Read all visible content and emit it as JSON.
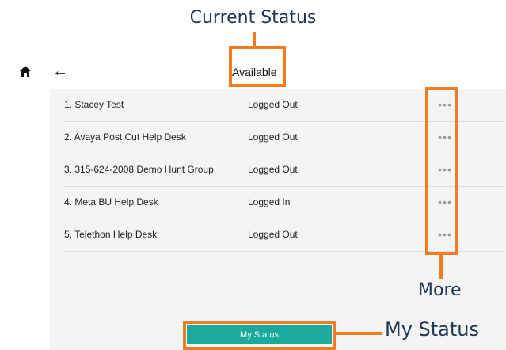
{
  "annotations": {
    "current_status": "Current Status",
    "more": "More",
    "my_status": "My Status"
  },
  "header": {
    "status": "Available"
  },
  "groups": [
    {
      "name": "1. Stacey Test",
      "state": "Logged Out"
    },
    {
      "name": "2. Avaya Post Cut Help Desk",
      "state": "Logged Out"
    },
    {
      "name": "3. 315-624-2008 Demo Hunt Group",
      "state": "Logged Out"
    },
    {
      "name": "4. Meta BU Help Desk",
      "state": "Logged In"
    },
    {
      "name": "5. Telethon Help Desk",
      "state": "Logged Out"
    }
  ],
  "more_glyph": "•••",
  "footer": {
    "my_status_label": "My Status"
  },
  "colors": {
    "accent": "#1aa99a",
    "highlight": "#ef7c23"
  },
  "icons": [
    "home-icon",
    "back-arrow-icon",
    "more-icon"
  ]
}
